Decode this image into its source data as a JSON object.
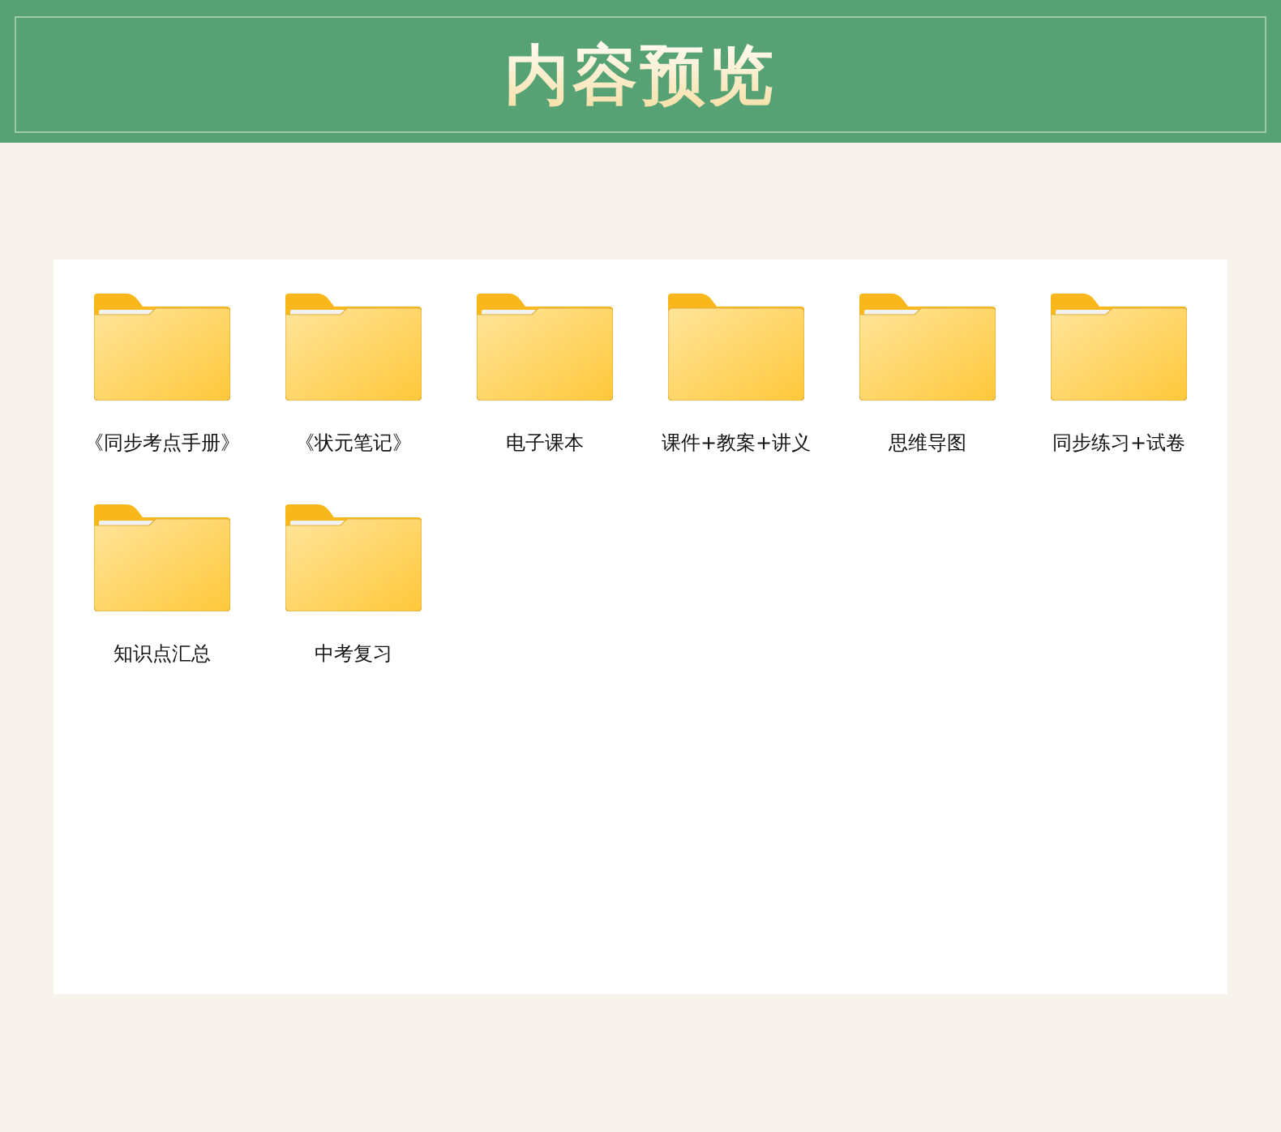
{
  "header": {
    "title": "内容预览"
  },
  "folders": [
    {
      "name": "《同步考点手册》",
      "empty": false
    },
    {
      "name": "《状元笔记》",
      "empty": false
    },
    {
      "name": "电子课本",
      "empty": false
    },
    {
      "name": "课件+教案+讲义",
      "empty": true
    },
    {
      "name": "思维导图",
      "empty": false
    },
    {
      "name": "同步练习+试卷",
      "empty": false
    },
    {
      "name": "知识点汇总",
      "empty": false
    },
    {
      "name": "中考复习",
      "empty": false
    }
  ]
}
